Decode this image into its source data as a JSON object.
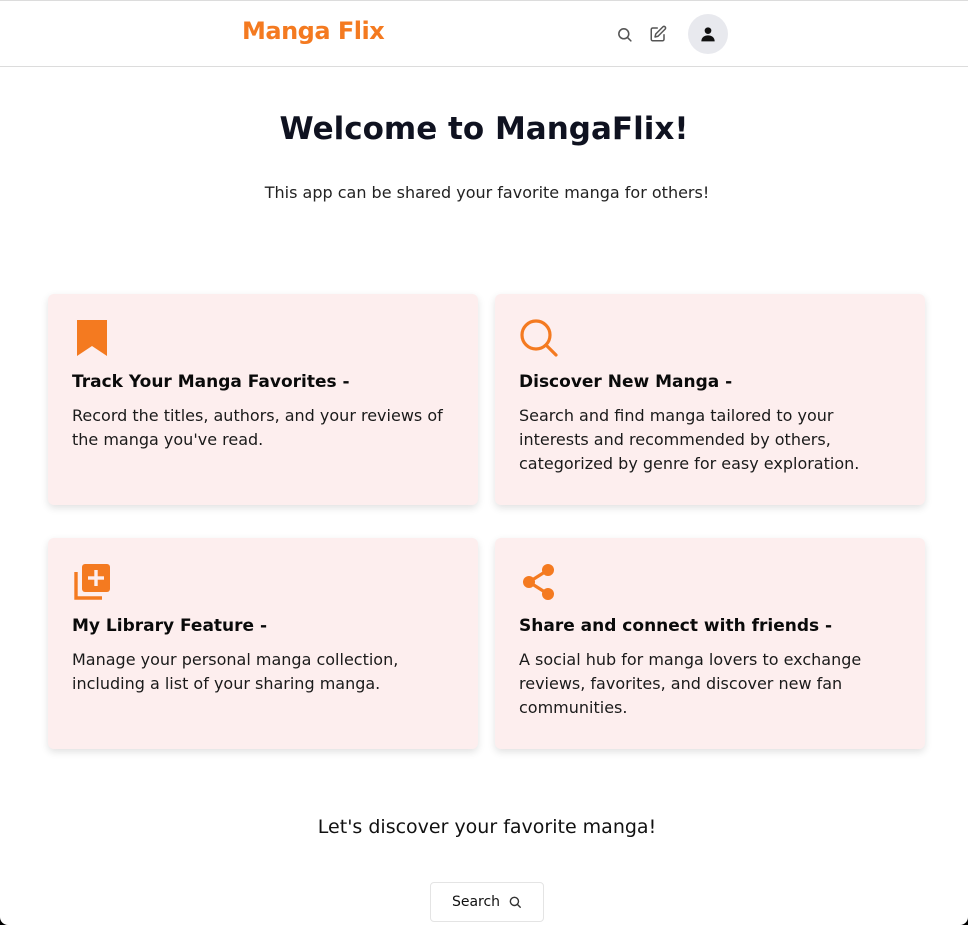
{
  "header": {
    "brand": "Manga Flix",
    "icons": [
      "search-icon",
      "edit-icon",
      "user-icon"
    ]
  },
  "hero": {
    "title": "Welcome to MangaFlix!",
    "subtitle": "This app can be shared your favorite manga for others!"
  },
  "features": [
    {
      "icon": "bookmark-icon",
      "title": "Track Your Manga Favorites -",
      "description": "Record the titles, authors, and your reviews of the manga you've read."
    },
    {
      "icon": "search-icon",
      "title": "Discover New Manga -",
      "description": "Search and find manga tailored to your interests and recommended by others, categorized by genre for easy exploration."
    },
    {
      "icon": "library-add-icon",
      "title": "My Library Feature -",
      "description": "Manage your personal manga collection, including a list of your sharing manga."
    },
    {
      "icon": "share-icon",
      "title": "Share and connect with friends -",
      "description": "A social hub for manga lovers to exchange reviews, favorites, and discover new fan communities."
    }
  ],
  "cta": {
    "text": "Let's discover your favorite manga!",
    "button_label": "Search"
  },
  "colors": {
    "accent": "#f47a20",
    "card_bg": "#fdeeee",
    "avatar_bg": "#e8e9ee"
  }
}
